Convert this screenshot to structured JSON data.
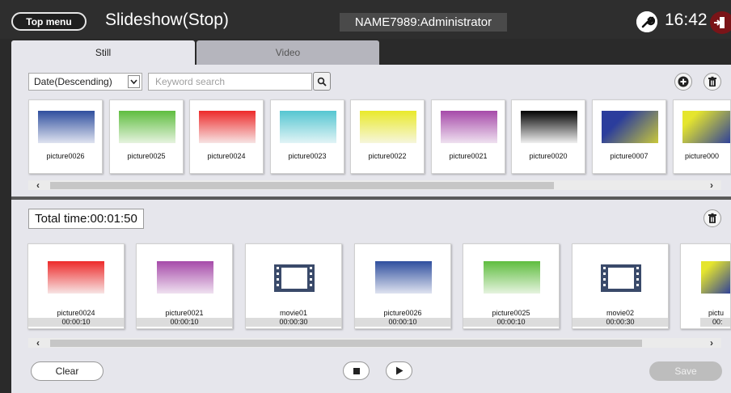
{
  "header": {
    "top_menu_label": "Top menu",
    "title": "Slideshow(Stop)",
    "user": "NAME7989:Administrator",
    "time": "16:42",
    "settings_icon": "wrench-icon",
    "logout_icon": "logout-icon"
  },
  "tabs": {
    "still": "Still",
    "video": "Video"
  },
  "filters": {
    "sort_value": "Date(Descending)",
    "search_placeholder": "Keyword search"
  },
  "library": {
    "items": [
      {
        "label": "picture0026"
      },
      {
        "label": "picture0025"
      },
      {
        "label": "picture0024"
      },
      {
        "label": "picture0023"
      },
      {
        "label": "picture0022"
      },
      {
        "label": "picture0021"
      },
      {
        "label": "picture0020"
      },
      {
        "label": "picture0007"
      },
      {
        "label": "picture000"
      }
    ]
  },
  "playlist": {
    "total_time": "Total time:00:01:50",
    "items": [
      {
        "label": "picture0024",
        "duration": "00:00:10"
      },
      {
        "label": "picture0021",
        "duration": "00:00:10"
      },
      {
        "label": "movie01",
        "duration": "00:00:30"
      },
      {
        "label": "picture0026",
        "duration": "00:00:10"
      },
      {
        "label": "picture0025",
        "duration": "00:00:10"
      },
      {
        "label": "movie02",
        "duration": "00:00:30"
      },
      {
        "label": "pictu",
        "duration": "00:"
      }
    ]
  },
  "footer": {
    "clear_label": "Clear",
    "save_label": "Save"
  },
  "colors": {
    "header_bg": "#2e2e2e",
    "panel_bg": "#e6e6ec",
    "logout_red": "#7a1418",
    "film_icon": "#3a4a6a"
  }
}
